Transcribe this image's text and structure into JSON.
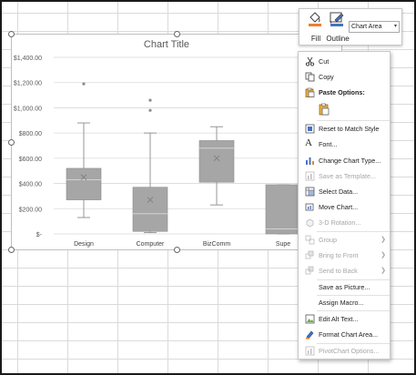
{
  "toolbar": {
    "fill_label": "Fill",
    "outline_label": "Outline",
    "element_select_value": "Chart Area",
    "fill_color": "#ED7D31",
    "outline_color": "#4472C4"
  },
  "chart": {
    "title": "Chart Title"
  },
  "chart_data": {
    "type": "box",
    "title": "Chart Title",
    "categories": [
      "Design",
      "Computer",
      "BizComm",
      "Supe"
    ],
    "ylim": [
      0,
      1400
    ],
    "y_ticks": [
      "$1,400.00",
      "$1,200.00",
      "$1,000.00",
      "$800.00",
      "$600.00",
      "$400.00",
      "$200.00",
      "$-"
    ],
    "tick_values": [
      1400,
      1200,
      1000,
      800,
      600,
      400,
      200,
      0
    ],
    "grid": true,
    "boxes": [
      {
        "name": "Design",
        "whisker_low": 130,
        "q1": 270,
        "median": 430,
        "q3": 520,
        "whisker_high": 880,
        "mean": 450,
        "outliers": [
          1190
        ]
      },
      {
        "name": "Computer",
        "whisker_low": 10,
        "q1": 20,
        "median": 160,
        "q3": 370,
        "whisker_high": 800,
        "mean": 270,
        "outliers": [
          980,
          1060
        ]
      },
      {
        "name": "BizComm",
        "whisker_low": 230,
        "q1": 410,
        "median": 680,
        "q3": 740,
        "whisker_high": 850,
        "mean": 600,
        "outliers": []
      },
      {
        "name": "Supe",
        "whisker_low": 0,
        "q1": 0,
        "median": 40,
        "q3": 390,
        "whisker_high": 390,
        "mean": null,
        "outliers": []
      }
    ],
    "box_color": "#A6A6A6",
    "mean_color": "#7F7F7F"
  },
  "menu": {
    "items": [
      {
        "label": "Cut",
        "icon": "scissors-icon",
        "enabled": true
      },
      {
        "label": "Copy",
        "icon": "copy-icon",
        "enabled": true
      },
      {
        "label": "Paste Options:",
        "icon": "paste-icon",
        "enabled": true,
        "bold": true
      },
      {
        "label": "Reset to Match Style",
        "icon": "reset-style-icon",
        "enabled": true
      },
      {
        "label": "Font...",
        "icon": "font-icon",
        "enabled": true
      },
      {
        "label": "Change Chart Type...",
        "icon": "chart-type-icon",
        "enabled": true
      },
      {
        "label": "Save as Template...",
        "icon": "template-icon",
        "enabled": false
      },
      {
        "label": "Select Data...",
        "icon": "select-data-icon",
        "enabled": true
      },
      {
        "label": "Move Chart...",
        "icon": "move-chart-icon",
        "enabled": true
      },
      {
        "label": "3-D Rotation...",
        "icon": "rotation-icon",
        "enabled": false
      },
      {
        "label": "Group",
        "icon": "group-icon",
        "enabled": false,
        "submenu": true
      },
      {
        "label": "Bring to Front",
        "icon": "bring-front-icon",
        "enabled": false,
        "submenu": true
      },
      {
        "label": "Send to Back",
        "icon": "send-back-icon",
        "enabled": false,
        "submenu": true
      },
      {
        "label": "Save as Picture...",
        "icon": "",
        "enabled": true
      },
      {
        "label": "Assign Macro...",
        "icon": "",
        "enabled": true
      },
      {
        "label": "Edit Alt Text...",
        "icon": "alt-text-icon",
        "enabled": true
      },
      {
        "label": "Format Chart Area...",
        "icon": "format-area-icon",
        "enabled": true
      },
      {
        "label": "PivotChart Options...",
        "icon": "pivot-icon",
        "enabled": false
      }
    ]
  }
}
